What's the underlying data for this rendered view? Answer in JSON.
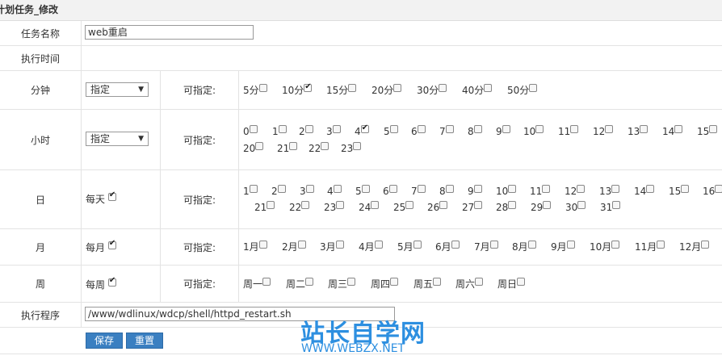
{
  "page": {
    "title": "计划任务_修改"
  },
  "task_name": {
    "label": "任务名称",
    "value": "web重启"
  },
  "exec_time": {
    "label": "执行时间"
  },
  "minute": {
    "label": "分钟",
    "select": "指定",
    "assign_label": "可指定:",
    "options": [
      {
        "t": "5分",
        "c": false
      },
      {
        "t": "10分",
        "c": true
      },
      {
        "t": "15分",
        "c": false
      },
      {
        "t": "20分",
        "c": false
      },
      {
        "t": "30分",
        "c": false
      },
      {
        "t": "40分",
        "c": false
      },
      {
        "t": "50分",
        "c": false
      }
    ]
  },
  "hour": {
    "label": "小时",
    "select": "指定",
    "assign_label": "可指定:",
    "options": [
      {
        "t": "0",
        "c": false
      },
      {
        "t": "1",
        "c": false
      },
      {
        "t": "2",
        "c": false
      },
      {
        "t": "3",
        "c": false
      },
      {
        "t": "4",
        "c": true
      },
      {
        "t": "5",
        "c": false
      },
      {
        "t": "6",
        "c": false
      },
      {
        "t": "7",
        "c": false
      },
      {
        "t": "8",
        "c": false
      },
      {
        "t": "9",
        "c": false
      },
      {
        "t": "10",
        "c": false
      },
      {
        "t": "11",
        "c": false
      },
      {
        "t": "12",
        "c": false
      },
      {
        "t": "13",
        "c": false
      },
      {
        "t": "14",
        "c": false
      },
      {
        "t": "15",
        "c": false
      },
      {
        "t": "20",
        "c": false
      },
      {
        "t": "21",
        "c": false
      },
      {
        "t": "22",
        "c": false
      },
      {
        "t": "23",
        "c": false
      }
    ]
  },
  "day": {
    "label": "日",
    "every": "每天",
    "every_checked": true,
    "assign_label": "可指定:",
    "options": [
      "1",
      "2",
      "3",
      "4",
      "5",
      "6",
      "7",
      "8",
      "9",
      "10",
      "11",
      "12",
      "13",
      "14",
      "15",
      "16",
      "21",
      "22",
      "23",
      "24",
      "25",
      "26",
      "27",
      "28",
      "29",
      "30",
      "31"
    ]
  },
  "month": {
    "label": "月",
    "every": "每月",
    "every_checked": true,
    "assign_label": "可指定:",
    "options": [
      "1月",
      "2月",
      "3月",
      "4月",
      "5月",
      "6月",
      "7月",
      "8月",
      "9月",
      "10月",
      "11月",
      "12月"
    ]
  },
  "week": {
    "label": "周",
    "every": "每周",
    "every_checked": true,
    "assign_label": "可指定:",
    "options": [
      "周一",
      "周二",
      "周三",
      "周四",
      "周五",
      "周六",
      "周日"
    ]
  },
  "program": {
    "label": "执行程序",
    "value": "/www/wdlinux/wdcp/shell/httpd_restart.sh"
  },
  "buttons": {
    "save": "保存",
    "reset": "重置"
  },
  "watermark": {
    "line1": "站长自学网",
    "line2": "WWW.WEBZX.NET"
  }
}
